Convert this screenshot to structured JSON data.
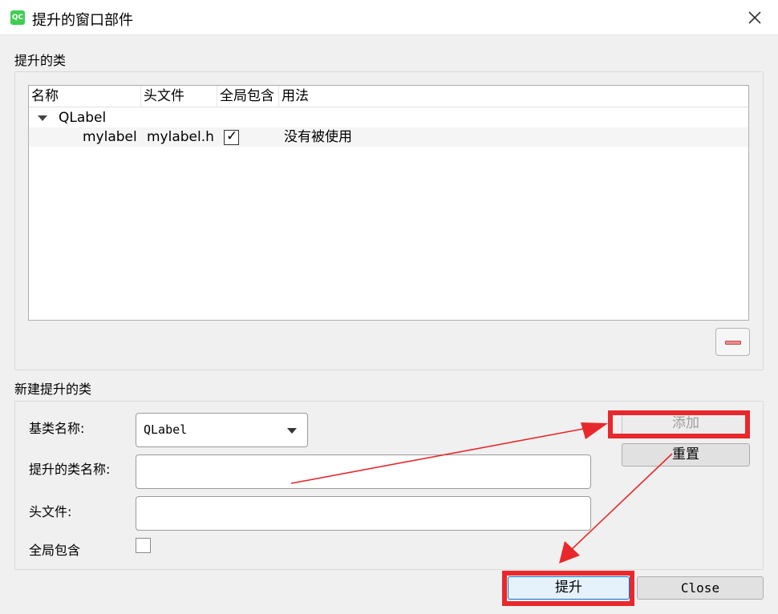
{
  "window": {
    "title": "提升的窗口部件",
    "icon_text": "QC",
    "icon": "qt-creator-icon",
    "close_icon": "close-icon"
  },
  "promoted_section": {
    "label": "提升的类",
    "columns": [
      "名称",
      "头文件",
      "全局包含",
      "用法"
    ],
    "tree": {
      "parent": "QLabel",
      "rows": [
        {
          "name": "mylabel",
          "header": "mylabel.h",
          "global_include": true,
          "usage": "没有被使用"
        }
      ]
    },
    "remove_icon": "minus-icon"
  },
  "new_section": {
    "label": "新建提升的类",
    "base_class_label": "基类名称:",
    "base_class_value": "QLabel",
    "promoted_class_label": "提升的类名称:",
    "promoted_class_value": "",
    "header_file_label": "头文件:",
    "header_file_value": "",
    "global_include_label": "全局包含",
    "global_include_checked": false,
    "add_button": "添加",
    "reset_button": "重置"
  },
  "footer": {
    "promote_button": "提升",
    "close_button": "Close"
  },
  "colors": {
    "annotation": "#e8282c",
    "qt_green": "#41cd52"
  }
}
